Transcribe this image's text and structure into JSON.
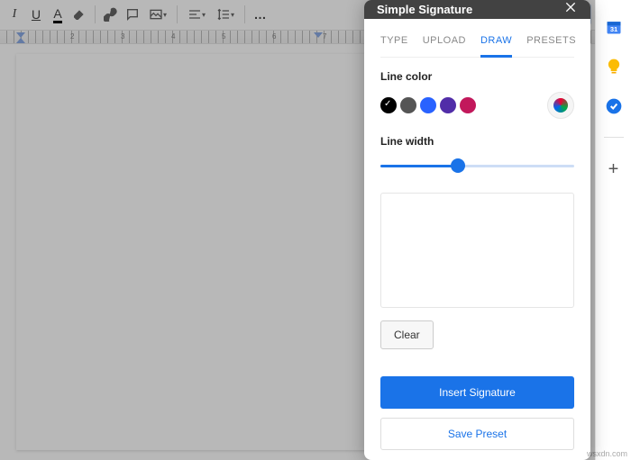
{
  "panel": {
    "title": "Simple Signature",
    "tabs": [
      "TYPE",
      "UPLOAD",
      "DRAW",
      "PRESETS"
    ],
    "active_tab": 2,
    "line_color_label": "Line color",
    "colors": [
      "#000000",
      "#555555",
      "#2962ff",
      "#512da8",
      "#c2185b"
    ],
    "selected_color": 0,
    "line_width_label": "Line width",
    "line_width_percent": 40,
    "clear_label": "Clear",
    "insert_label": "Insert Signature",
    "save_label": "Save Preset"
  },
  "ruler": {
    "marks": [
      "2",
      "3",
      "4",
      "5",
      "6",
      "7"
    ]
  },
  "watermark": "wsxdn.com"
}
